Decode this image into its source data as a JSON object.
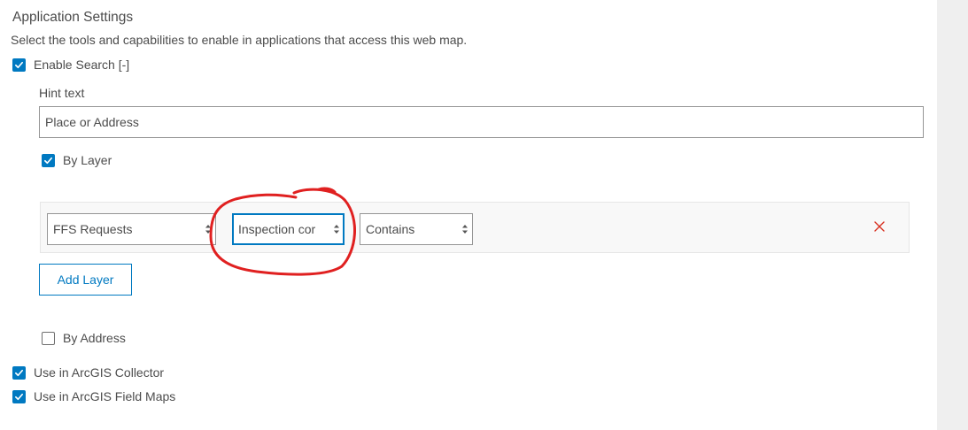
{
  "section": {
    "title": "Application Settings",
    "description": "Select the tools and capabilities to enable in applications that access this web map."
  },
  "enable_search": {
    "label": "Enable Search [-]",
    "checked": true
  },
  "hint": {
    "label": "Hint text",
    "value": "Place or Address"
  },
  "by_layer": {
    "label": "By Layer",
    "checked": true
  },
  "layer_row": {
    "layer_select": "FFS Requests",
    "field_select": "Inspection cor",
    "operator_select": "Contains"
  },
  "add_layer_label": "Add Layer",
  "by_address": {
    "label": "By Address",
    "checked": false
  },
  "collector": {
    "label": "Use in ArcGIS Collector",
    "checked": true
  },
  "field_maps": {
    "label": "Use in ArcGIS Field Maps",
    "checked": true
  },
  "colors": {
    "accent": "#0079c1",
    "remove": "#d83020",
    "annotation": "#e02020"
  },
  "icons": {
    "checkbox_checked": "checkmark-icon",
    "select_arrows": "up-down-arrows-icon",
    "remove": "close-icon"
  }
}
